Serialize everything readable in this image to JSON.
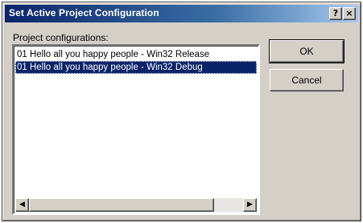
{
  "window": {
    "title": "Set Active Project Configuration",
    "help_glyph": "?",
    "close_glyph": "×"
  },
  "main": {
    "label": "Project configurations:",
    "list_items": [
      "01 Hello all you happy people - Win32 Release",
      "01 Hello all you happy people - Win32 Debug"
    ],
    "selected_index": 1
  },
  "scrollbar": {
    "left_arrow": "◀",
    "right_arrow": "▶"
  },
  "buttons": {
    "ok_label": "OK",
    "cancel_label": "Cancel"
  },
  "colors": {
    "title_gradient_start": "#0a246a",
    "title_gradient_end": "#a6caf0",
    "dialog_face": "#d4d0c8",
    "selection": "#0a246a"
  }
}
